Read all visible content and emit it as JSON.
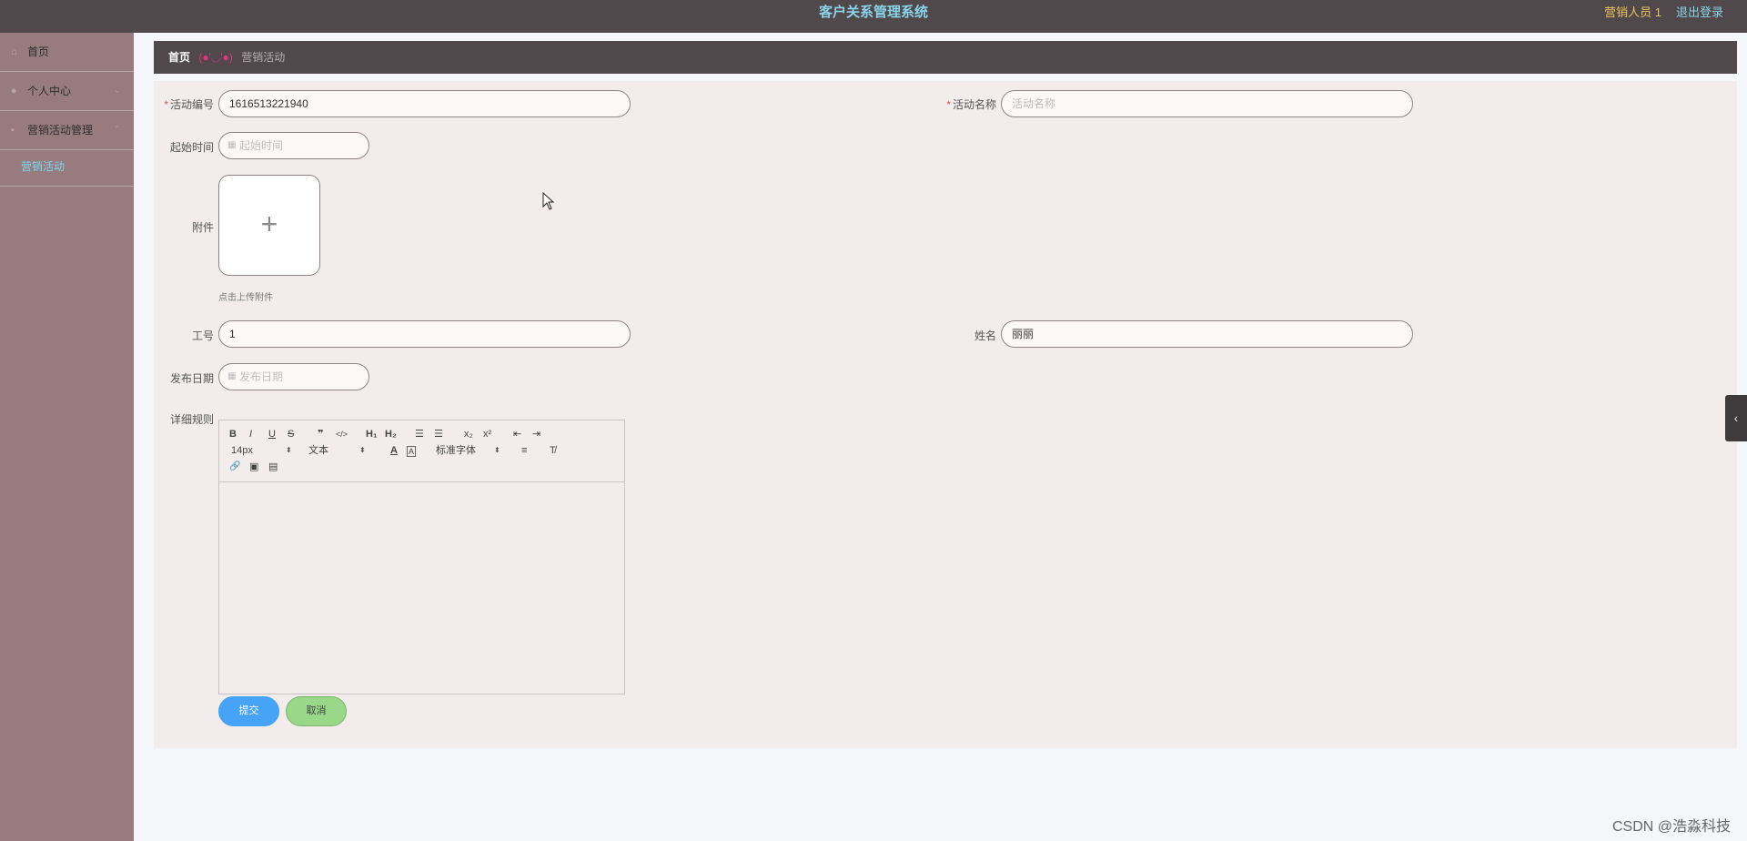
{
  "header": {
    "title": "客户关系管理系统",
    "user": "营销人员 1",
    "logout": "退出登录"
  },
  "sidebar": {
    "items": [
      {
        "label": "首页",
        "icon": "home-icon"
      },
      {
        "label": "个人中心",
        "icon": "user-icon"
      },
      {
        "label": "营销活动管理",
        "icon": "menu-icon"
      }
    ],
    "submenu": [
      {
        "label": "营销活动",
        "active": true
      }
    ]
  },
  "breadcrumb": {
    "home": "首页",
    "separator": "(●'◡'●)",
    "current": "营销活动"
  },
  "form": {
    "activity_no": {
      "label": "活动编号",
      "required": true,
      "value": "1616513221940"
    },
    "activity_name": {
      "label": "活动名称",
      "required": true,
      "value": "",
      "placeholder": "活动名称"
    },
    "start_time": {
      "label": "起始时间",
      "placeholder": "起始时间"
    },
    "attachment": {
      "label": "附件",
      "tip": "点击上传附件"
    },
    "employee_no": {
      "label": "工号",
      "value": "1"
    },
    "name": {
      "label": "姓名",
      "value": "丽丽"
    },
    "publish_date": {
      "label": "发布日期",
      "placeholder": "发布日期"
    },
    "details": {
      "label": "详细规则"
    }
  },
  "editor": {
    "toolbar": {
      "bold": "B",
      "italic": "I",
      "underline": "U",
      "strike": "S",
      "quote": "❞",
      "code": "</>",
      "h1": "H₁",
      "h2": "H₂",
      "ordered_list": "☰",
      "bullet_list": "☰",
      "subscript": "x₂",
      "superscript": "x²",
      "indent_less": "⇤",
      "indent_more": "⇥",
      "font_size": "14px",
      "text_type": "文本",
      "font_family": "标准字体",
      "color": "A",
      "background": "A",
      "align": "≡",
      "clean": "T̸",
      "link": "🔗",
      "image": "▣",
      "video": "▤"
    }
  },
  "buttons": {
    "submit": "提交",
    "cancel": "取消"
  },
  "misc": {
    "right_tab": "‹",
    "watermark": "CSDN @浩淼科技"
  }
}
